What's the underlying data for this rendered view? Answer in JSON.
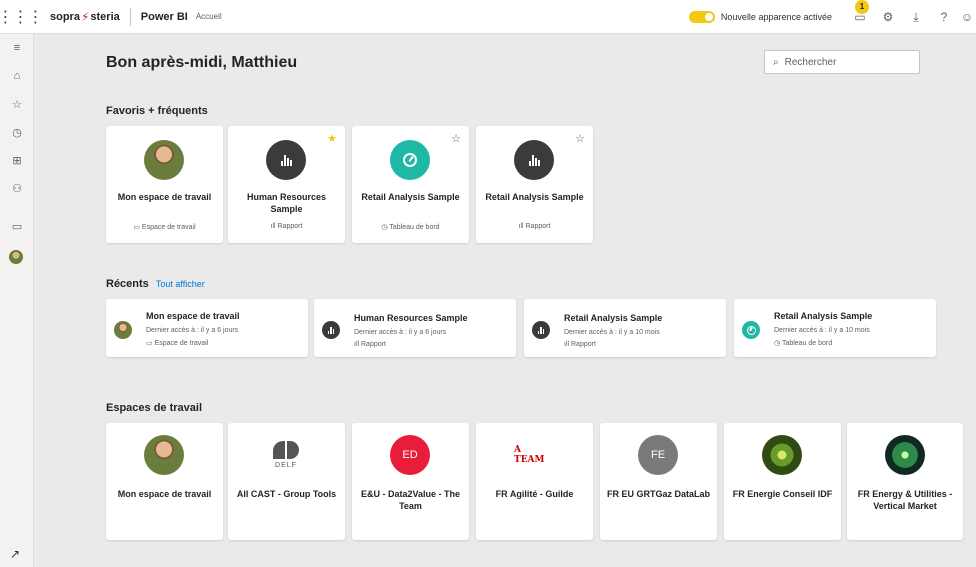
{
  "topbar": {
    "company_prefix": "sopra",
    "company_suffix": "steria",
    "product": "Power BI",
    "breadcrumb": "Accueil",
    "new_look_label": "Nouvelle apparence activée",
    "notification_count": "1"
  },
  "greeting": "Bon après-midi, Matthieu",
  "search": {
    "placeholder": "Rechercher"
  },
  "favorites": {
    "title": "Favoris + fréquents",
    "items": [
      {
        "name": "Mon espace de travail",
        "type": "Espace de travail",
        "icon": "workspace-icon",
        "starred": false
      },
      {
        "name": "Human Resources Sample",
        "type": "Rapport",
        "icon": "report-icon",
        "starred": true
      },
      {
        "name": "Retail Analysis Sample",
        "type": "Tableau de bord",
        "icon": "dashboard-icon",
        "starred": false
      },
      {
        "name": "Retail Analysis Sample",
        "type": "Rapport",
        "icon": "report-icon",
        "starred": false
      }
    ]
  },
  "recents": {
    "title": "Récents",
    "see_all": "Tout afficher",
    "items": [
      {
        "name": "Mon espace de travail",
        "meta": "Dernier accès à : il y a 6 jours",
        "type": "Espace de travail"
      },
      {
        "name": "Human Resources Sample",
        "meta": "Dernier accès à : il y a 6 jours",
        "type": "Rapport"
      },
      {
        "name": "Retail Analysis Sample",
        "meta": "Dernier accès à : il y a 10 mois",
        "type": "Rapport"
      },
      {
        "name": "Retail Analysis Sample",
        "meta": "Dernier accès à : il y a 10 mois",
        "type": "Tableau de bord"
      }
    ]
  },
  "workspaces": {
    "title": "Espaces de travail",
    "items": [
      {
        "name": "Mon espace de travail",
        "badge": ""
      },
      {
        "name": "All CAST - Group Tools",
        "badge": "DELF"
      },
      {
        "name": "E&U - Data2Value - The Team",
        "badge": "ED"
      },
      {
        "name": "FR Agilité - Guilde",
        "badge": "A TEAM"
      },
      {
        "name": "FR EU GRTGaz DataLab",
        "badge": "FE"
      },
      {
        "name": "FR Energie Conseil IDF",
        "badge": ""
      },
      {
        "name": "FR Energy & Utilities - Vertical Market",
        "badge": ""
      }
    ]
  },
  "colors": {
    "accent": "#f2c811",
    "link": "#0078d4",
    "teal": "#1fb8a7",
    "red": "#e81d3a"
  }
}
